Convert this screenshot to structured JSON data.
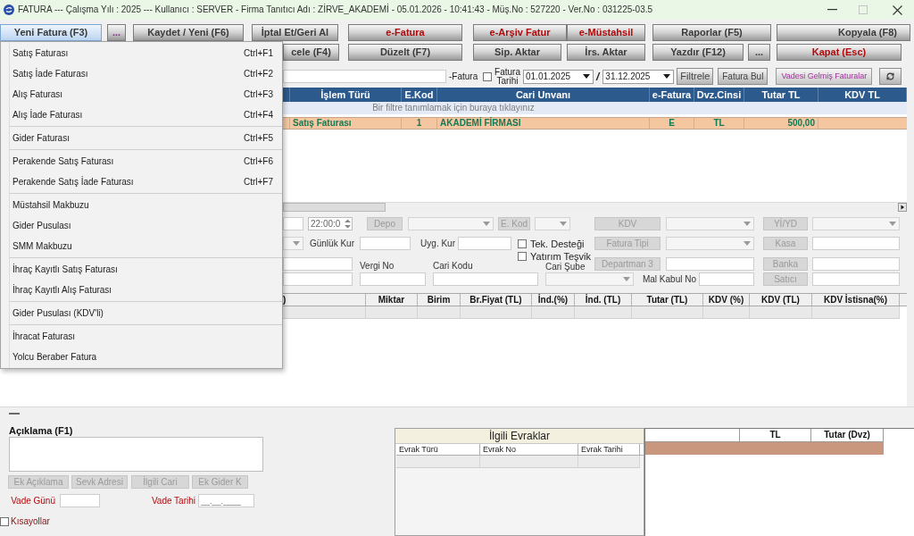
{
  "window": {
    "title": "FATURA --- Çalışma Yılı : 2025 --- Kullanıcı : SERVER - Firma Tanıtıcı Adı : ZİRVE_AKADEMİ - 05.01.2026 - 10:41:43 - Müş.No : 527220 - Ver.No : 031225-03.5",
    "maximize_disabled": true
  },
  "toolbar": {
    "row_1": [
      {
        "label": "Yeni Fatura (F3)",
        "kind": "normal",
        "pressed": true
      },
      {
        "label": "...",
        "kind": "accent",
        "pressed": false
      },
      {
        "label": "Kaydet / Yeni (F6)",
        "kind": "normal",
        "pressed": false
      },
      {
        "label": "İptal Et/Geri Al",
        "kind": "normal",
        "pressed": false
      },
      {
        "label": "e-Fatura",
        "kind": "alert",
        "pressed": false
      },
      {
        "label": "e-Arşiv Fatur",
        "kind": "alert",
        "pressed": false
      },
      {
        "label": "e-Müstahsil",
        "kind": "alert",
        "pressed": false
      },
      {
        "label": "Raporlar (F5)",
        "kind": "normal",
        "pressed": false
      },
      {
        "label": "Kopyala (F8)",
        "kind": "normal",
        "pressed": false
      }
    ],
    "row_2": [
      {
        "label": "cele (F4)",
        "kind": "normal",
        "pressed": false
      },
      {
        "label": "Düzelt (F7)",
        "kind": "normal",
        "pressed": false
      },
      {
        "label": "Sip. Aktar",
        "kind": "normal",
        "pressed": false
      },
      {
        "label": "İrs. Aktar",
        "kind": "normal",
        "pressed": false
      },
      {
        "label": "Yazdır (F12)",
        "kind": "normal",
        "pressed": false
      },
      {
        "label": "...",
        "kind": "normal",
        "pressed": false
      },
      {
        "label": "Kapat (Esc)",
        "kind": "alert",
        "pressed": false
      }
    ]
  },
  "new_invoice_menu": {
    "groups": [
      [
        {
          "label": "Satış Faturası",
          "shortcut": "Ctrl+F1"
        },
        {
          "label": "Satış İade Faturası",
          "shortcut": "Ctrl+F2"
        },
        {
          "label": "Alış Faturası",
          "shortcut": "Ctrl+F3"
        },
        {
          "label": "Alış İade Faturası",
          "shortcut": "Ctrl+F4"
        }
      ],
      [
        {
          "label": "Gider Faturası",
          "shortcut": "Ctrl+F5"
        }
      ],
      [
        {
          "label": "Perakende Satış Faturası",
          "shortcut": "Ctrl+F6"
        },
        {
          "label": "Perakende Satış İade Faturası",
          "shortcut": "Ctrl+F7"
        }
      ],
      [
        {
          "label": "Müstahsil Makbuzu"
        },
        {
          "label": "Gider Pusulası"
        },
        {
          "label": "SMM Makbuzu"
        }
      ],
      [
        {
          "label": "İhraç Kayıtlı Satış Faturası"
        },
        {
          "label": "İhraç Kayıtlı Alış Faturası"
        }
      ],
      [
        {
          "label": "Gider Pusulası (KDV'li)"
        }
      ],
      [
        {
          "label": "İhracat Faturası"
        },
        {
          "label": "Yolcu Beraber Fatura"
        }
      ]
    ]
  },
  "filter_bar": {
    "e_invoice": {
      "label": "-Fatura",
      "checked": false
    },
    "date_label": "Fatura Tarihi",
    "date_from": "01.01.2025",
    "range_separator": "/",
    "date_to": "31.12.2025",
    "buttons": [
      "Filtrele",
      "Fatura Bul"
    ],
    "due_invoices_button": "Vadesi Gelmiş Faturalar"
  },
  "invoice_table": {
    "columns": [
      "İşlem Türü",
      "E.Kod",
      "Cari Unvanı",
      "e-Fatura",
      "Dvz.Cinsi",
      "Tutar TL",
      "KDV TL"
    ],
    "filter_hint": "Bir filtre tanımlamak için buraya tıklayınız",
    "rows": [
      {
        "cells": [
          "Satış Faturası",
          "1",
          "AKADEMİ FİRMASI",
          "E",
          "TL",
          "500,00"
        ],
        "selected": true
      }
    ]
  },
  "document_form": {
    "time": "22:00:0",
    "warehouse_button": {
      "label": "Depo",
      "disabled": true
    },
    "e_code_button": {
      "label": "E. Kod",
      "disabled": true
    },
    "vat_button": {
      "label": "KDV",
      "disabled": true
    },
    "yi_yd_button": {
      "label": "Yİ/YD",
      "disabled": true
    },
    "daily_rate_label": "Günlük Kur",
    "applied_rate_label": "Uyg. Kur",
    "tech_support": {
      "label": "Tek. Desteği",
      "checked": false
    },
    "invoice_type_button": {
      "label": "Fatura Tipi",
      "disabled": true
    },
    "cash_button": {
      "label": "Kasa",
      "disabled": true
    },
    "tax_no_label": "Vergi No",
    "account_code_label": "Cari Kodu",
    "investment_incentive": {
      "label": "Yatırım Teşvik",
      "checked": false
    },
    "account_branch_label": "Cari Şube",
    "department_button": {
      "label": "Departman 3",
      "disabled": true
    },
    "bank_button": {
      "label": "Banka",
      "disabled": true
    },
    "goods_receipt_label": "Mal Kabul No",
    "seller_button": {
      "label": "Satıcı",
      "disabled": true
    }
  },
  "items_table": {
    "columns": [
      ")",
      "Miktar",
      "Birim",
      "Br.Fiyat (TL)",
      "İnd.(%)",
      "İnd. (TL)",
      "Tutar (TL)",
      "KDV (%)",
      "KDV (TL)",
      "KDV İstisna(%)"
    ]
  },
  "notes": {
    "label": "Açıklama (F1)",
    "buttons": [
      {
        "label": "Ek Açıklama",
        "disabled": true
      },
      {
        "label": "Sevk Adresi",
        "disabled": true
      },
      {
        "label": "İlgili Cari",
        "disabled": true
      },
      {
        "label": "Ek Gider K",
        "disabled": true
      }
    ],
    "due_days_label": "Vade Günü",
    "due_date_label": "Vade Tarihi",
    "due_date_placeholder": "__.__.____"
  },
  "shortcuts": {
    "label": "Kısayollar",
    "checked": false
  },
  "related_documents": {
    "title": "İlgili Evraklar",
    "columns": [
      "Evrak Türü",
      "Evrak No",
      "Evrak Tarihi"
    ]
  },
  "totals": {
    "columns": [
      "TL",
      "Tutar (Dvz)"
    ]
  }
}
